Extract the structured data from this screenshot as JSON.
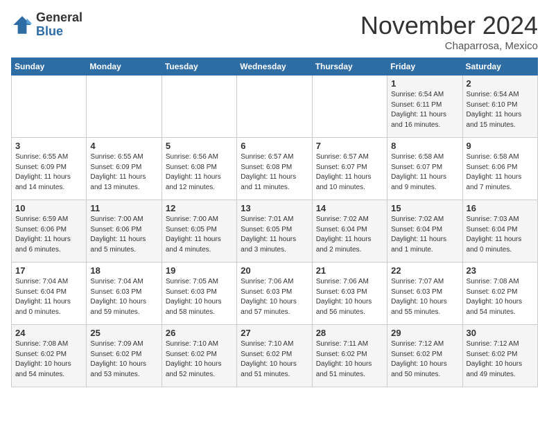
{
  "logo": {
    "general": "General",
    "blue": "Blue"
  },
  "title": "November 2024",
  "location": "Chaparrosa, Mexico",
  "days_of_week": [
    "Sunday",
    "Monday",
    "Tuesday",
    "Wednesday",
    "Thursday",
    "Friday",
    "Saturday"
  ],
  "weeks": [
    [
      {
        "day": "",
        "info": ""
      },
      {
        "day": "",
        "info": ""
      },
      {
        "day": "",
        "info": ""
      },
      {
        "day": "",
        "info": ""
      },
      {
        "day": "",
        "info": ""
      },
      {
        "day": "1",
        "info": "Sunrise: 6:54 AM\nSunset: 6:11 PM\nDaylight: 11 hours\nand 16 minutes."
      },
      {
        "day": "2",
        "info": "Sunrise: 6:54 AM\nSunset: 6:10 PM\nDaylight: 11 hours\nand 15 minutes."
      }
    ],
    [
      {
        "day": "3",
        "info": "Sunrise: 6:55 AM\nSunset: 6:09 PM\nDaylight: 11 hours\nand 14 minutes."
      },
      {
        "day": "4",
        "info": "Sunrise: 6:55 AM\nSunset: 6:09 PM\nDaylight: 11 hours\nand 13 minutes."
      },
      {
        "day": "5",
        "info": "Sunrise: 6:56 AM\nSunset: 6:08 PM\nDaylight: 11 hours\nand 12 minutes."
      },
      {
        "day": "6",
        "info": "Sunrise: 6:57 AM\nSunset: 6:08 PM\nDaylight: 11 hours\nand 11 minutes."
      },
      {
        "day": "7",
        "info": "Sunrise: 6:57 AM\nSunset: 6:07 PM\nDaylight: 11 hours\nand 10 minutes."
      },
      {
        "day": "8",
        "info": "Sunrise: 6:58 AM\nSunset: 6:07 PM\nDaylight: 11 hours\nand 9 minutes."
      },
      {
        "day": "9",
        "info": "Sunrise: 6:58 AM\nSunset: 6:06 PM\nDaylight: 11 hours\nand 7 minutes."
      }
    ],
    [
      {
        "day": "10",
        "info": "Sunrise: 6:59 AM\nSunset: 6:06 PM\nDaylight: 11 hours\nand 6 minutes."
      },
      {
        "day": "11",
        "info": "Sunrise: 7:00 AM\nSunset: 6:06 PM\nDaylight: 11 hours\nand 5 minutes."
      },
      {
        "day": "12",
        "info": "Sunrise: 7:00 AM\nSunset: 6:05 PM\nDaylight: 11 hours\nand 4 minutes."
      },
      {
        "day": "13",
        "info": "Sunrise: 7:01 AM\nSunset: 6:05 PM\nDaylight: 11 hours\nand 3 minutes."
      },
      {
        "day": "14",
        "info": "Sunrise: 7:02 AM\nSunset: 6:04 PM\nDaylight: 11 hours\nand 2 minutes."
      },
      {
        "day": "15",
        "info": "Sunrise: 7:02 AM\nSunset: 6:04 PM\nDaylight: 11 hours\nand 1 minute."
      },
      {
        "day": "16",
        "info": "Sunrise: 7:03 AM\nSunset: 6:04 PM\nDaylight: 11 hours\nand 0 minutes."
      }
    ],
    [
      {
        "day": "17",
        "info": "Sunrise: 7:04 AM\nSunset: 6:04 PM\nDaylight: 11 hours\nand 0 minutes."
      },
      {
        "day": "18",
        "info": "Sunrise: 7:04 AM\nSunset: 6:03 PM\nDaylight: 10 hours\nand 59 minutes."
      },
      {
        "day": "19",
        "info": "Sunrise: 7:05 AM\nSunset: 6:03 PM\nDaylight: 10 hours\nand 58 minutes."
      },
      {
        "day": "20",
        "info": "Sunrise: 7:06 AM\nSunset: 6:03 PM\nDaylight: 10 hours\nand 57 minutes."
      },
      {
        "day": "21",
        "info": "Sunrise: 7:06 AM\nSunset: 6:03 PM\nDaylight: 10 hours\nand 56 minutes."
      },
      {
        "day": "22",
        "info": "Sunrise: 7:07 AM\nSunset: 6:03 PM\nDaylight: 10 hours\nand 55 minutes."
      },
      {
        "day": "23",
        "info": "Sunrise: 7:08 AM\nSunset: 6:02 PM\nDaylight: 10 hours\nand 54 minutes."
      }
    ],
    [
      {
        "day": "24",
        "info": "Sunrise: 7:08 AM\nSunset: 6:02 PM\nDaylight: 10 hours\nand 54 minutes."
      },
      {
        "day": "25",
        "info": "Sunrise: 7:09 AM\nSunset: 6:02 PM\nDaylight: 10 hours\nand 53 minutes."
      },
      {
        "day": "26",
        "info": "Sunrise: 7:10 AM\nSunset: 6:02 PM\nDaylight: 10 hours\nand 52 minutes."
      },
      {
        "day": "27",
        "info": "Sunrise: 7:10 AM\nSunset: 6:02 PM\nDaylight: 10 hours\nand 51 minutes."
      },
      {
        "day": "28",
        "info": "Sunrise: 7:11 AM\nSunset: 6:02 PM\nDaylight: 10 hours\nand 51 minutes."
      },
      {
        "day": "29",
        "info": "Sunrise: 7:12 AM\nSunset: 6:02 PM\nDaylight: 10 hours\nand 50 minutes."
      },
      {
        "day": "30",
        "info": "Sunrise: 7:12 AM\nSunset: 6:02 PM\nDaylight: 10 hours\nand 49 minutes."
      }
    ]
  ]
}
